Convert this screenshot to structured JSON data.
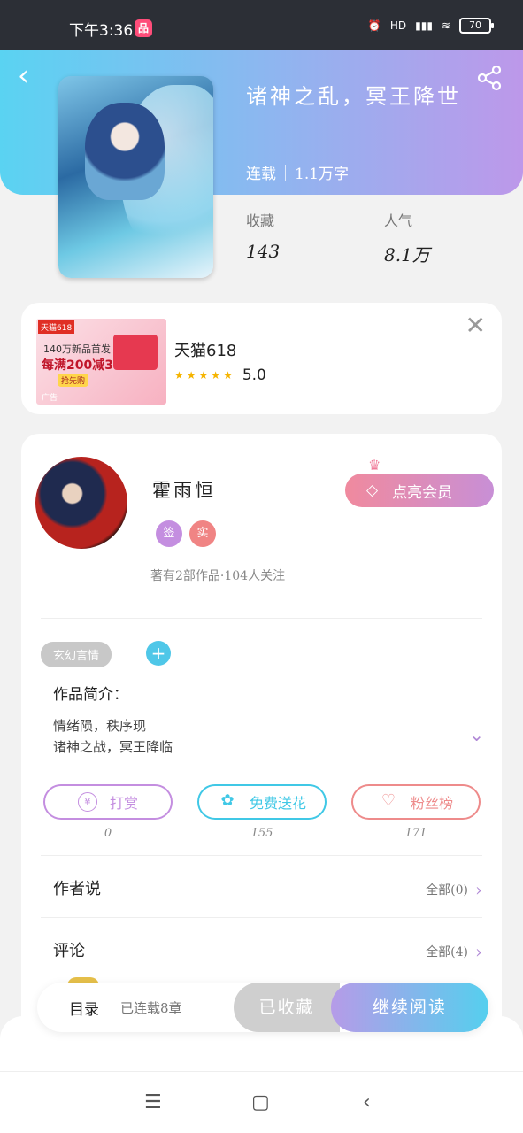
{
  "status_bar": {
    "time": "下午3:36",
    "app_icon_text": "品",
    "hd": "HD",
    "battery": "70"
  },
  "book": {
    "title": "诸神之乱，冥王降世",
    "status": "连载",
    "word_count": "1.1万字",
    "stats": [
      {
        "label": "收藏",
        "value": "143"
      },
      {
        "label": "人气",
        "value": "8.1万"
      }
    ]
  },
  "ad": {
    "image_lines": [
      "天猫618",
      "140万新品首发",
      "每满200减30",
      "抢先购",
      "广告"
    ],
    "name": "天猫618",
    "rating": "5.0",
    "stars": 5
  },
  "author": {
    "name": "霍雨恒",
    "badges": [
      "签",
      "实"
    ],
    "info": "著有2部作品·104人关注",
    "vip_button": "点亮会员"
  },
  "genre_tag": "玄幻言情",
  "intro": {
    "label": "作品简介：",
    "lines": [
      "情绪陨，秩序现",
      "诸神之战，冥王降临"
    ]
  },
  "actions": [
    {
      "label": "打赏",
      "count": "0",
      "color": "#c48ee0"
    },
    {
      "label": "免费送花",
      "count": "155",
      "color": "#40c8e6"
    },
    {
      "label": "粉丝榜",
      "count": "171",
      "color": "#ee8b8b"
    }
  ],
  "sections": [
    {
      "title": "作者说",
      "more": "全部(0)"
    },
    {
      "title": "评论",
      "more": "全部(4)"
    }
  ],
  "bottom_bar": {
    "toc": "目录",
    "toc_sub": "已连载8章",
    "collected": "已收藏",
    "continue": "继续阅读"
  },
  "colors": {
    "header_start": "#5ad3f2",
    "header_end": "#bd98ea",
    "accent_purple": "#b088d6"
  },
  "icons": [
    "back-icon",
    "share-icon",
    "close-icon",
    "crown-icon",
    "diamond-icon",
    "plus-icon",
    "chevron-down-icon",
    "yen-icon",
    "flower-icon",
    "fans-icon",
    "chevron-right-icon",
    "menu-icon",
    "home-icon",
    "back-nav-icon"
  ]
}
